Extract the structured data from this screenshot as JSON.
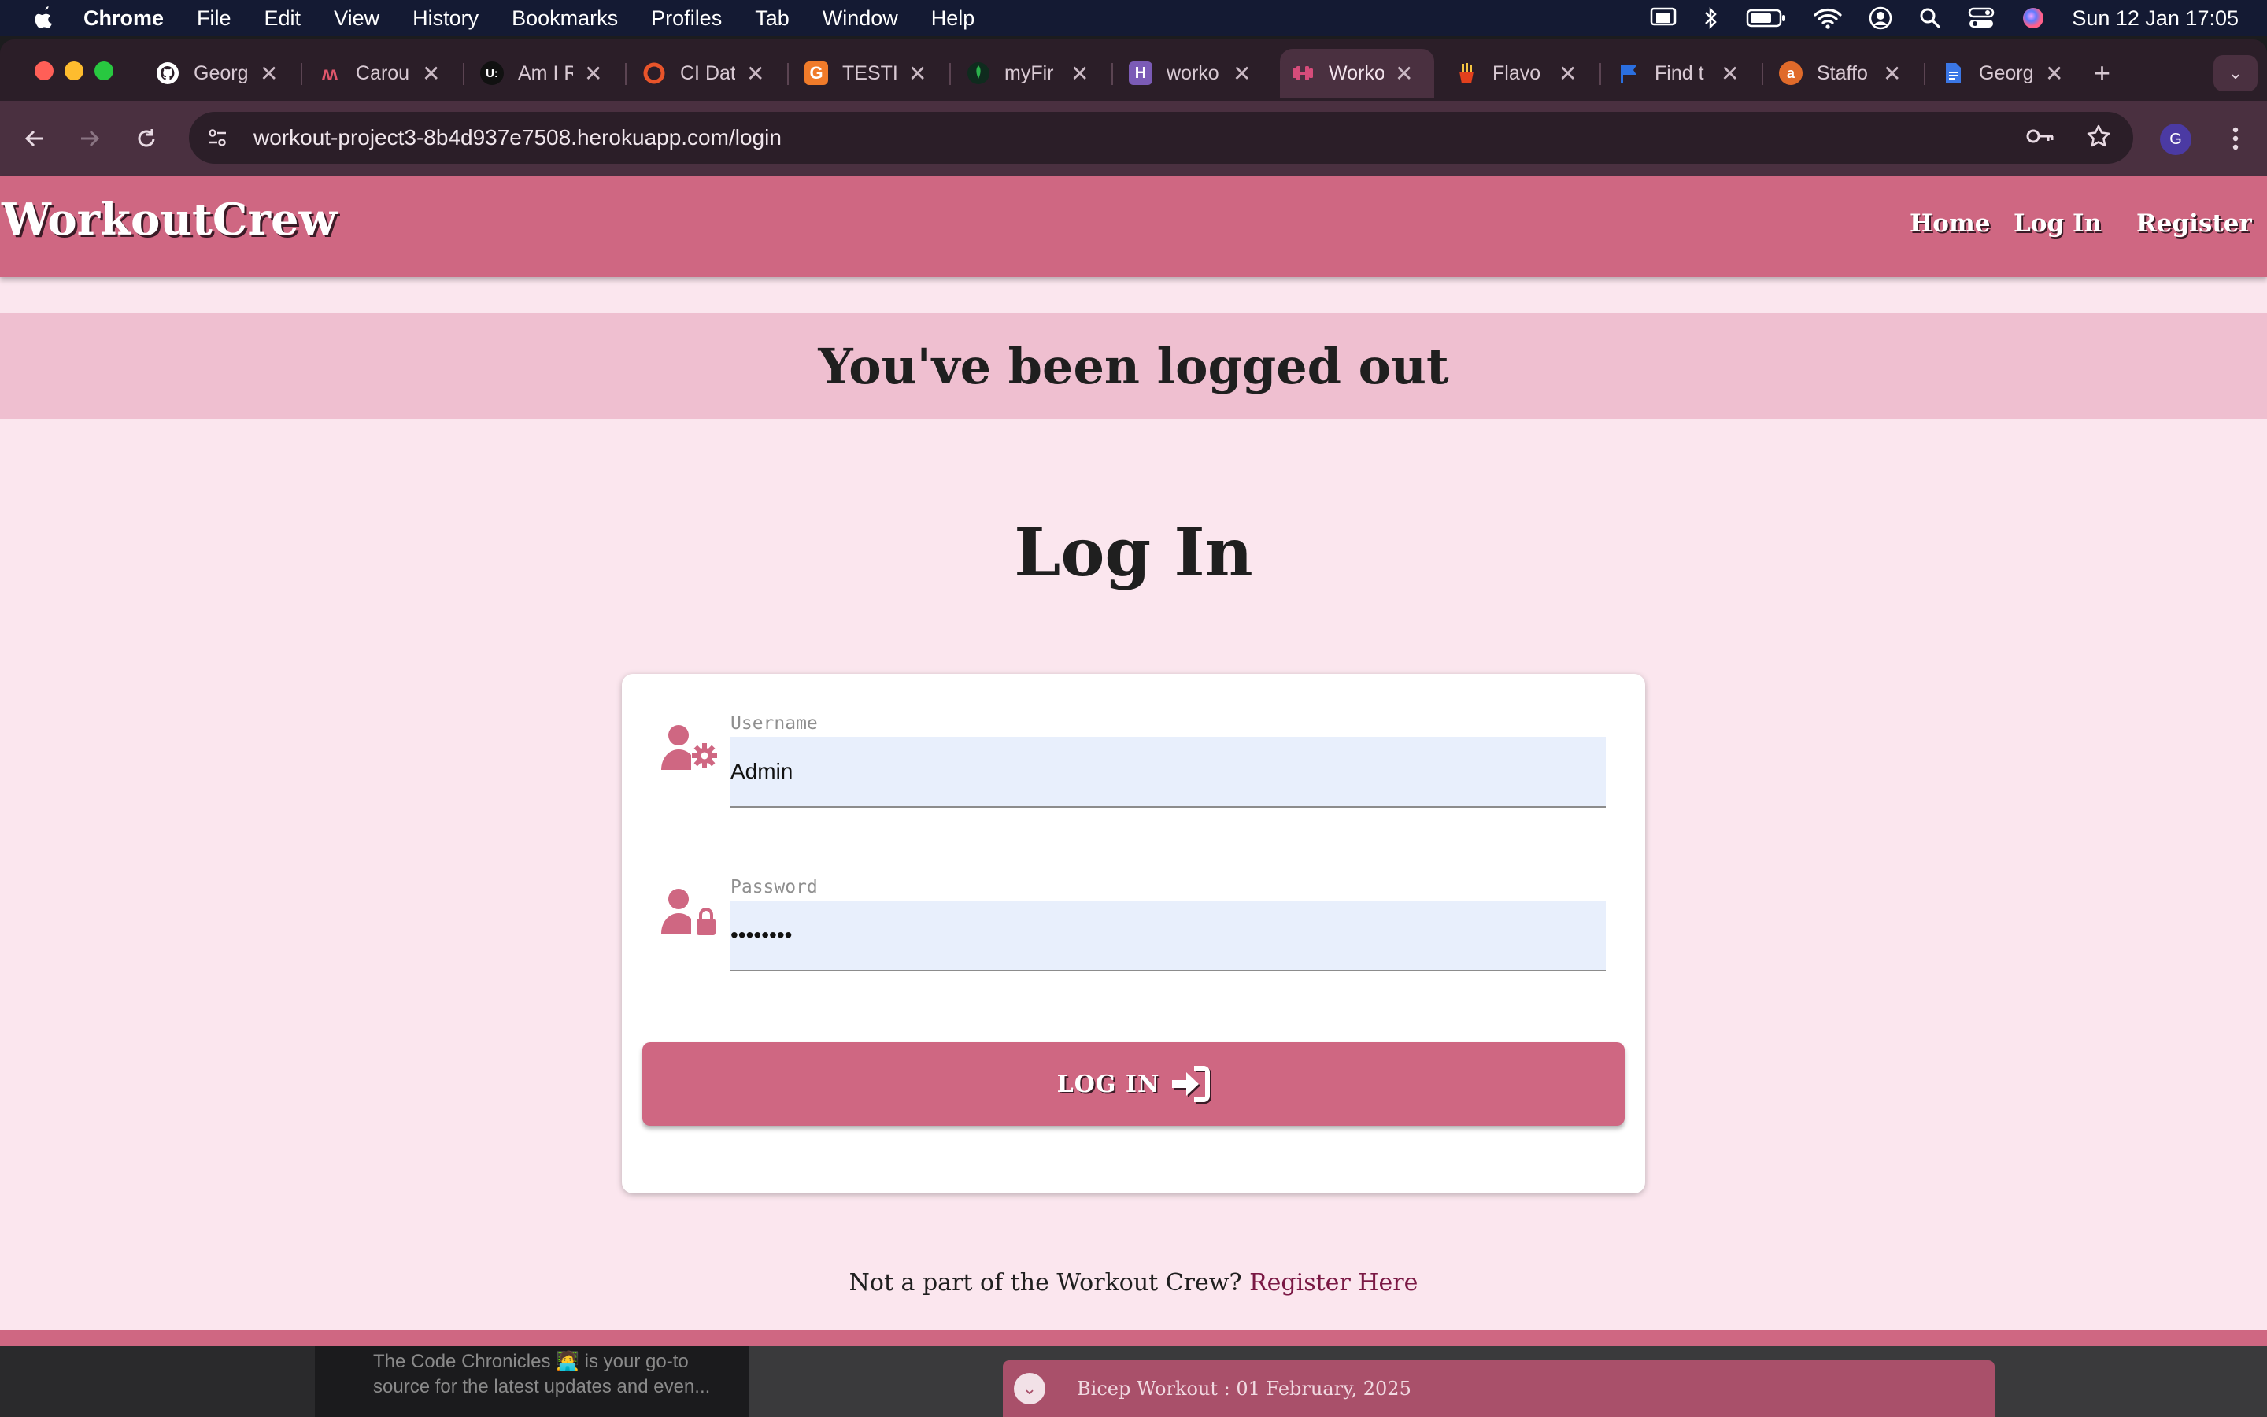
{
  "menubar": {
    "app": "Chrome",
    "items": [
      "File",
      "Edit",
      "View",
      "History",
      "Bookmarks",
      "Profiles",
      "Tab",
      "Window",
      "Help"
    ],
    "clock": "Sun 12 Jan  17:05"
  },
  "tabs": [
    {
      "title": "Georg",
      "fav_color": "#ffffff",
      "fav_text": "",
      "icon": "github-icon"
    },
    {
      "title": "Carou",
      "fav_color": "#e0566b",
      "fav_text": "M",
      "icon": "carousel-icon"
    },
    {
      "title": "Am I R",
      "fav_color": "#111111",
      "fav_text": "U:",
      "icon": "am-i-responsive-icon"
    },
    {
      "title": "CI Dat",
      "fav_color": "#e8542a",
      "fav_text": "",
      "icon": "ring-icon"
    },
    {
      "title": "TESTI",
      "fav_color": "#f07b2a",
      "fav_text": "G",
      "icon": "testing-icon"
    },
    {
      "title": "myFir",
      "fav_color": "#2bb24c",
      "fav_text": "",
      "icon": "leaf-icon"
    },
    {
      "title": "worko",
      "fav_color": "#7b5bb6",
      "fav_text": "H",
      "icon": "heroku-icon"
    },
    {
      "title": "Worko",
      "fav_color": "#d64c7a",
      "fav_text": "",
      "icon": "dumbbell-icon",
      "active": true
    },
    {
      "title": "Flavo",
      "fav_color": "#e2401d",
      "fav_text": "",
      "icon": "fries-icon"
    },
    {
      "title": "Find t",
      "fav_color": "#2b6fe0",
      "fav_text": "",
      "icon": "flag-icon"
    },
    {
      "title": "Staffo",
      "fav_color": "#e06a2a",
      "fav_text": "a",
      "icon": "staffo-icon"
    },
    {
      "title": "Georg",
      "fav_color": "#3b77e6",
      "fav_text": "",
      "icon": "docs-icon"
    }
  ],
  "address": {
    "url": "workout-project3-8b4d937e7508.herokuapp.com/login",
    "profile_initial": "G"
  },
  "site": {
    "brand": "WorkoutCrew",
    "nav": {
      "home": "Home",
      "login": "Log In",
      "register": "Register"
    },
    "alert": "You've been logged out",
    "title": "Log In",
    "username": {
      "label": "Username",
      "value": "Admin"
    },
    "password": {
      "label": "Password",
      "value": "••••••••"
    },
    "button": "LOG IN",
    "register_prompt": "Not a part of the Workout Crew?",
    "register_link": "Register Here",
    "colors": {
      "accent": "#cf6782",
      "background": "#fbe6ee",
      "alert": "#efbfd0"
    }
  },
  "background": {
    "panel_lines": [
      "The Code Chronicles 🧑‍💻 is your go-to",
      "source for the latest updates and even..."
    ],
    "toast": "Bicep Workout : 01 February, 2025"
  }
}
